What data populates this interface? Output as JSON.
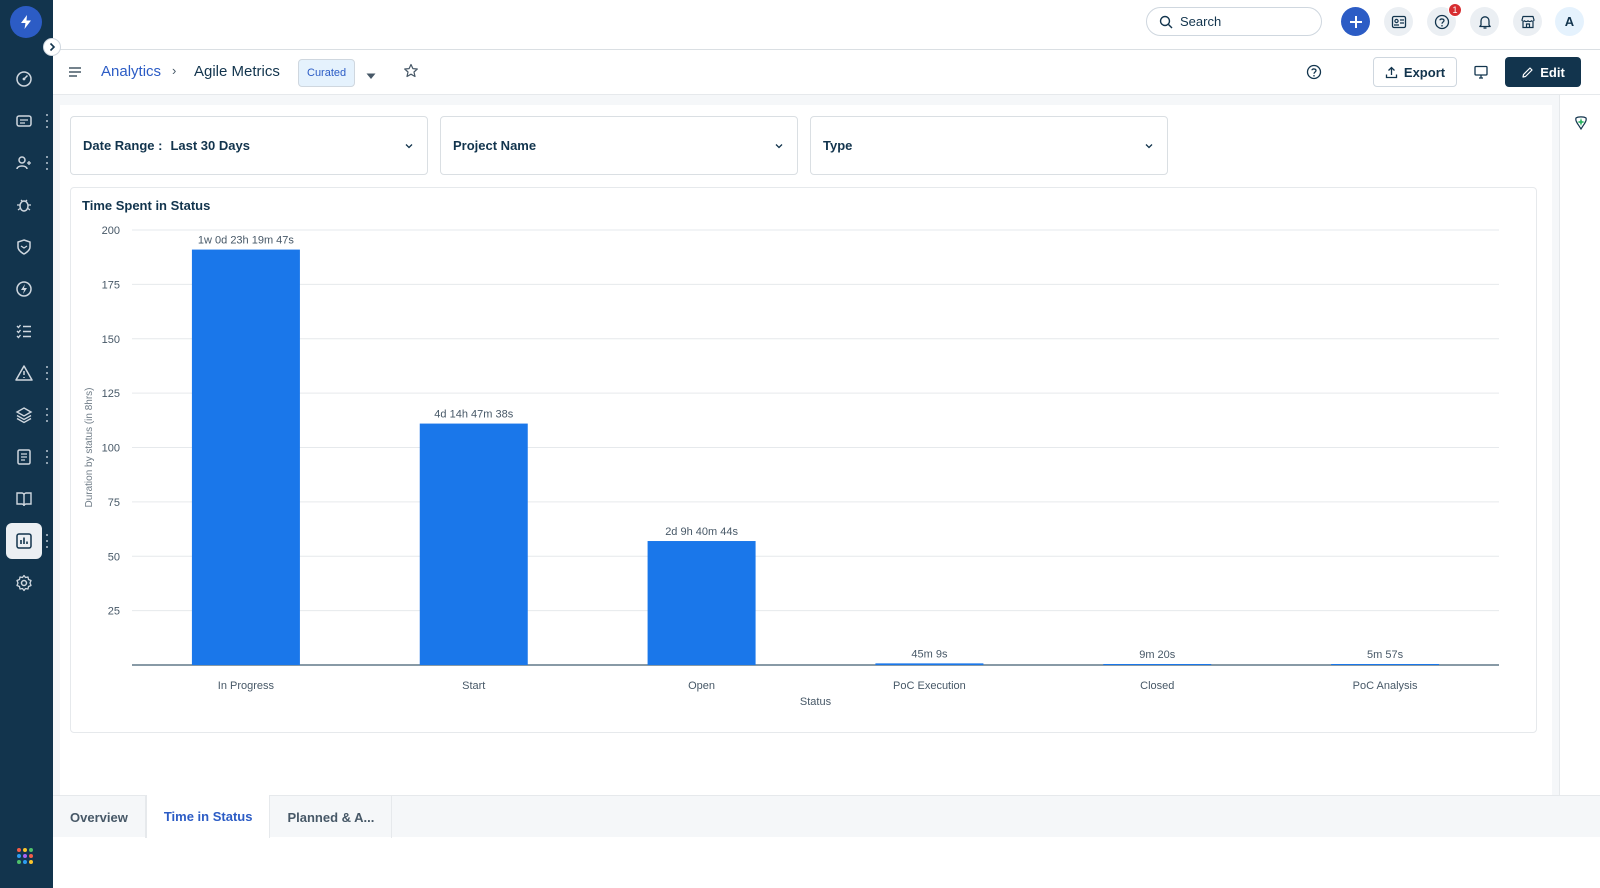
{
  "topbar": {
    "search_placeholder": "Search",
    "help_badge": "1",
    "avatar_initial": "A"
  },
  "header": {
    "breadcrumb_root": "Analytics",
    "breadcrumb_sep": "›",
    "title": "Agile Metrics",
    "curated_label": "Curated",
    "export_label": "Export",
    "edit_label": "Edit"
  },
  "filters": [
    {
      "label": "Date Range :",
      "value": "Last 30 Days"
    },
    {
      "label": "Project Name",
      "value": ""
    },
    {
      "label": "Type",
      "value": ""
    }
  ],
  "sidebar": {
    "icons": [
      "logo-bolt-icon",
      "gauge-icon",
      "ticket-icon",
      "contacts-icon",
      "bug-icon",
      "shield-icon",
      "bolt-icon",
      "checklist-icon",
      "warning-icon",
      "layers-icon",
      "document-icon",
      "book-icon",
      "analytics-icon",
      "settings-icon",
      "apps-grid-icon"
    ]
  },
  "tabs": [
    {
      "label": "Overview",
      "active": false
    },
    {
      "label": "Time in Status",
      "active": true
    },
    {
      "label": "Planned & A...",
      "active": false
    }
  ],
  "colors": {
    "bar": "#1a77ea",
    "accent": "#2c5cc5",
    "rail": "#12344d"
  },
  "chart_data": {
    "type": "bar",
    "title": "Time Spent in Status",
    "xlabel": "Status",
    "ylabel": "Duration by status (in 8hrs)",
    "ylim": [
      0,
      200
    ],
    "yticks": [
      25,
      50,
      75,
      100,
      125,
      150,
      175,
      200
    ],
    "grid": true,
    "categories": [
      "In Progress",
      "Start",
      "Open",
      "PoC Execution",
      "Closed",
      "PoC Analysis"
    ],
    "values": [
      191,
      111,
      57,
      0.75,
      0.16,
      0.1
    ],
    "data_labels": [
      "1w 0d 23h 19m 47s",
      "4d 14h 47m 38s",
      "2d 9h 40m 44s",
      "45m 9s",
      "9m 20s",
      "5m 57s"
    ]
  }
}
